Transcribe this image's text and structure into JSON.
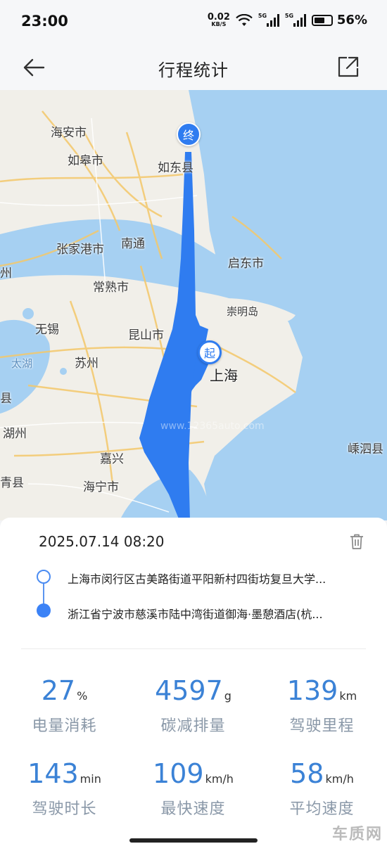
{
  "status": {
    "time": "23:00",
    "net_speed": "0.02",
    "net_unit": "KB/S",
    "sig1": "5G",
    "sig2": "5G",
    "battery": "56%"
  },
  "header": {
    "title": "行程统计",
    "back_icon": "arrow-left-icon",
    "share_icon": "share-icon"
  },
  "map": {
    "cities": {
      "haian": "海安市",
      "rugao": "如皋市",
      "rudong": "如东县",
      "nantong": "南通",
      "zhangjiagang": "张家港市",
      "qidong": "启东市",
      "changshu": "常熟市",
      "chongming": "崇明岛",
      "wuxi": "无锡",
      "kunshan": "昆山市",
      "suzhou": "苏州",
      "taihu": "太湖",
      "shanghai": "上海",
      "huzhou": "湖州",
      "jiaxing": "嘉兴",
      "haining": "海宁市",
      "shengsi": "嵊泗县",
      "left1": "州",
      "left2": "县",
      "left3": "青县"
    },
    "start_label": "起",
    "end_label": "终",
    "watermark": "www.12365auto.com"
  },
  "trip": {
    "date": "2025.07.14 08:20",
    "origin": "上海市闵行区古美路街道平阳新村四街坊复旦大学...",
    "destination": "浙江省宁波市慈溪市陆中湾街道御海·墨憩酒店(杭..."
  },
  "stats": [
    {
      "value": "27",
      "unit": "%",
      "label": "电量消耗"
    },
    {
      "value": "4597",
      "unit": "g",
      "label": "碳减排量"
    },
    {
      "value": "139",
      "unit": "km",
      "label": "驾驶里程"
    },
    {
      "value": "143",
      "unit": "min",
      "label": "驾驶时长"
    },
    {
      "value": "109",
      "unit": "km/h",
      "label": "最快速度"
    },
    {
      "value": "58",
      "unit": "km/h",
      "label": "平均速度"
    }
  ],
  "corner_logo": "车质网"
}
